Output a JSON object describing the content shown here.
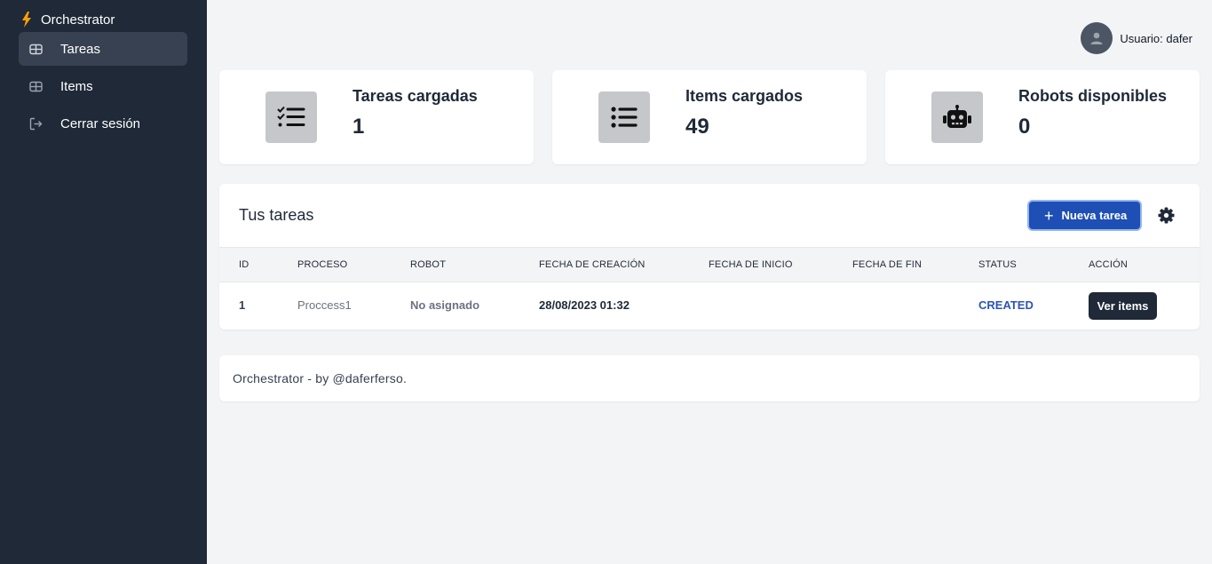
{
  "app": {
    "title": "Orchestrator"
  },
  "sidebar": {
    "items": [
      {
        "label": "Tareas",
        "icon": "table-icon",
        "active": true
      },
      {
        "label": "Items",
        "icon": "table-icon",
        "active": false
      },
      {
        "label": "Cerrar sesión",
        "icon": "logout-icon",
        "active": false
      }
    ]
  },
  "user": {
    "label": "Usuario: dafer"
  },
  "stats": [
    {
      "title": "Tareas cargadas",
      "value": "1",
      "icon": "checklist-icon"
    },
    {
      "title": "Items cargados",
      "value": "49",
      "icon": "list-icon"
    },
    {
      "title": "Robots disponibles",
      "value": "0",
      "icon": "robot-icon"
    }
  ],
  "tasks": {
    "title": "Tus tareas",
    "new_button": "Nueva tarea",
    "columns": [
      "ID",
      "PROCESO",
      "ROBOT",
      "FECHA DE CREACIÓN",
      "FECHA DE INICIO",
      "FECHA DE FIN",
      "STATUS",
      "ACCIÓN"
    ],
    "rows": [
      {
        "id": "1",
        "process": "Proccess1",
        "robot": "No asignado",
        "created": "28/08/2023 01:32",
        "start": "",
        "end": "",
        "status": "CREATED",
        "action": "Ver items"
      }
    ]
  },
  "footer": {
    "text": "Orchestrator - by @daferferso."
  },
  "colors": {
    "sidebar": "#1f2937",
    "accent": "#1e4fb4",
    "bolt": "#f59e0b",
    "status": "#2b55b5"
  }
}
